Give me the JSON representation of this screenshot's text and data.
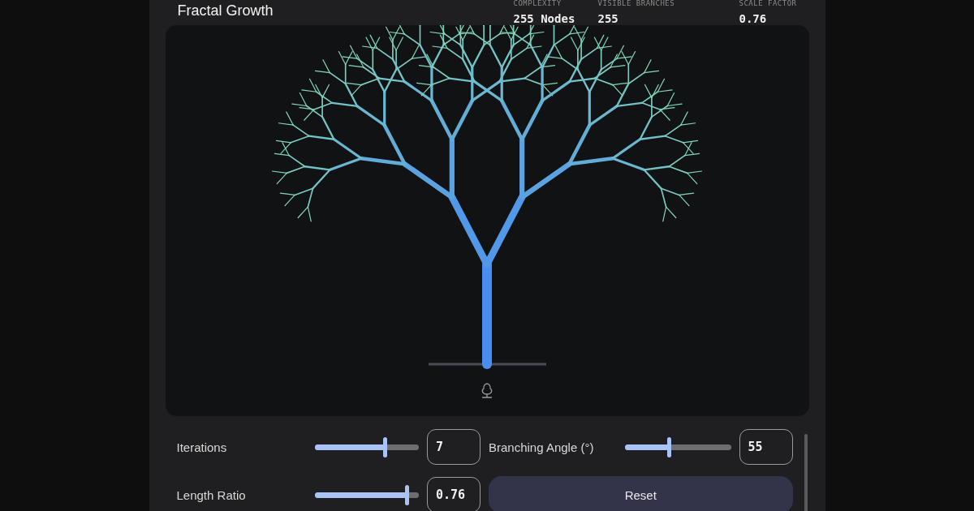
{
  "title": "Fractal Growth",
  "stats": [
    {
      "label": "COMPLEXITY",
      "value": "255 Nodes"
    },
    {
      "label": "VISIBLE BRANCHES",
      "value": "255"
    },
    {
      "label": "SCALE FACTOR",
      "value": "0.76"
    }
  ],
  "controls": [
    {
      "kind": "slider",
      "label": "Iterations",
      "level": 0.67,
      "value": "7"
    },
    {
      "kind": "slider",
      "label": "Branching Angle (°)",
      "level": 0.41,
      "value": "55"
    },
    {
      "kind": "slider",
      "label": "Length Ratio",
      "level": 0.88,
      "value": "0.76"
    },
    {
      "kind": "button",
      "label": "Reset"
    }
  ]
}
